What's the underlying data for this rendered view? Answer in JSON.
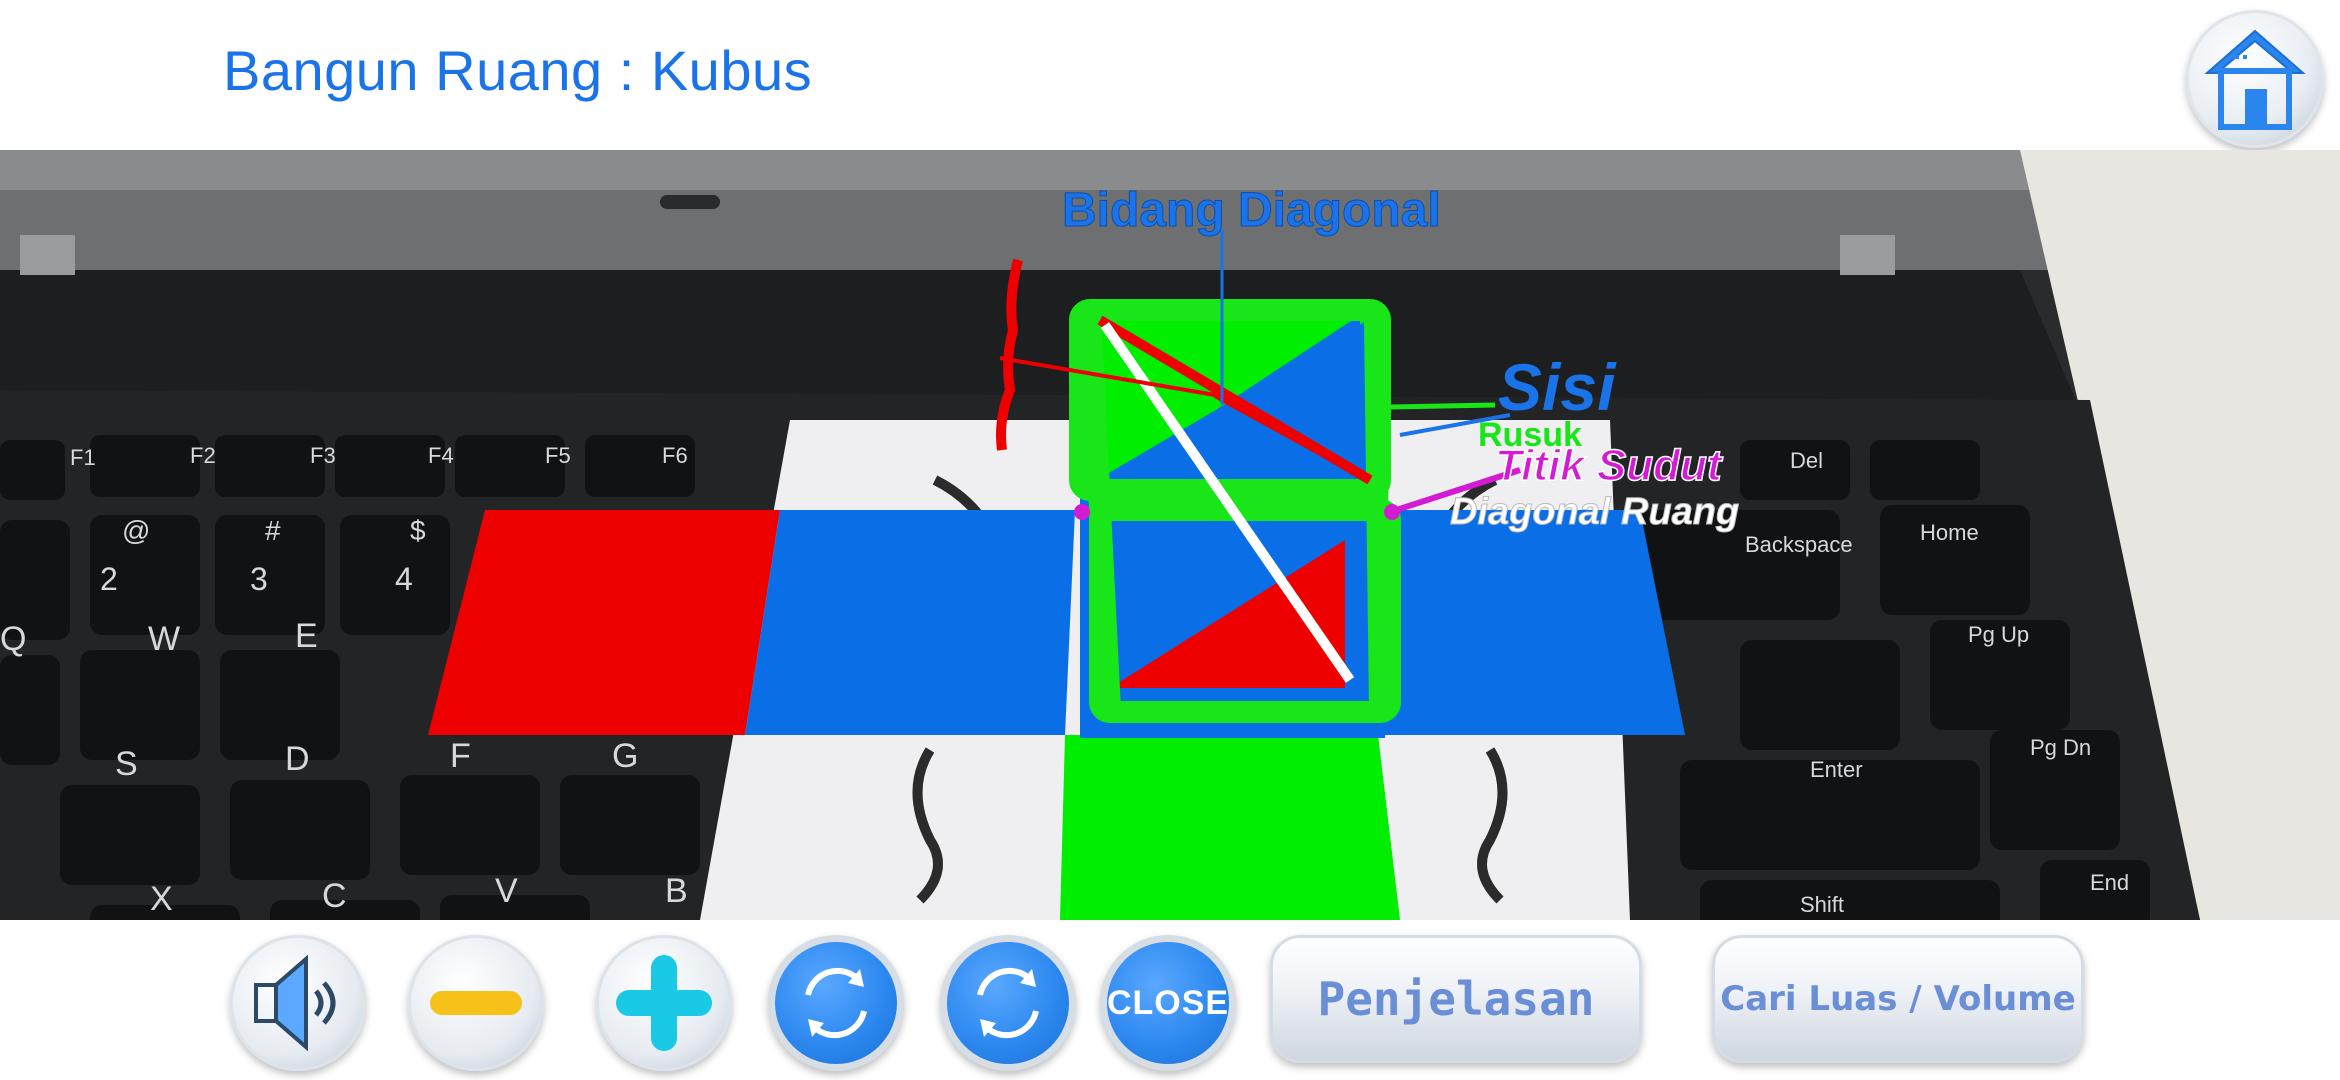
{
  "header": {
    "title": "Bangun Ruang : Kubus",
    "home_button": {
      "icon": "home-icon"
    }
  },
  "ar_scene": {
    "labels": {
      "bidang_diagonal": "Bidang Diagonal",
      "sisi": "Sisi",
      "rusuk": "Rusuk",
      "titik_sudut": "Titik Sudut",
      "diagonal_ruang": "Diagonal Ruang"
    },
    "label_colors": {
      "bidang_diagonal": "#1a73e8",
      "sisi": "#1a73e8",
      "rusuk": "#19e619",
      "titik_sudut": "#d21bd2",
      "diagonal_ruang": "#ffffff"
    },
    "net_colors": {
      "red": "#ee0000",
      "blue": "#0a6fe6",
      "green": "#00ee00"
    },
    "keyboard_keys": {
      "f1": "F1",
      "f2": "F2",
      "f3": "F3",
      "f4": "F4",
      "f5": "F5",
      "f6": "F6",
      "at": "@",
      "two": "2",
      "hash": "#",
      "three": "3",
      "dollar": "$",
      "four": "4",
      "q": "Q",
      "w": "W",
      "e": "E",
      "s": "S",
      "d": "D",
      "f": "F",
      "g": "G",
      "x": "X",
      "c": "C",
      "v": "V",
      "b": "B",
      "del": "Del",
      "backspace": "Backspace",
      "home": "Home",
      "pgup": "Pg Up",
      "enter": "Enter",
      "pgdn": "Pg Dn",
      "shift": "Shift",
      "end": "End"
    }
  },
  "toolbar": {
    "sound_button": {
      "icon": "speaker-icon"
    },
    "zoom_out_button": {
      "icon": "minus-icon"
    },
    "zoom_in_button": {
      "icon": "plus-icon"
    },
    "rotate_left_button": {
      "icon": "rotate-icon"
    },
    "rotate_right_button": {
      "icon": "rotate-icon"
    },
    "close_label": "CLOSE",
    "penjelasan_label": "Penjelasan",
    "cari_label": "Cari Luas / Volume"
  }
}
